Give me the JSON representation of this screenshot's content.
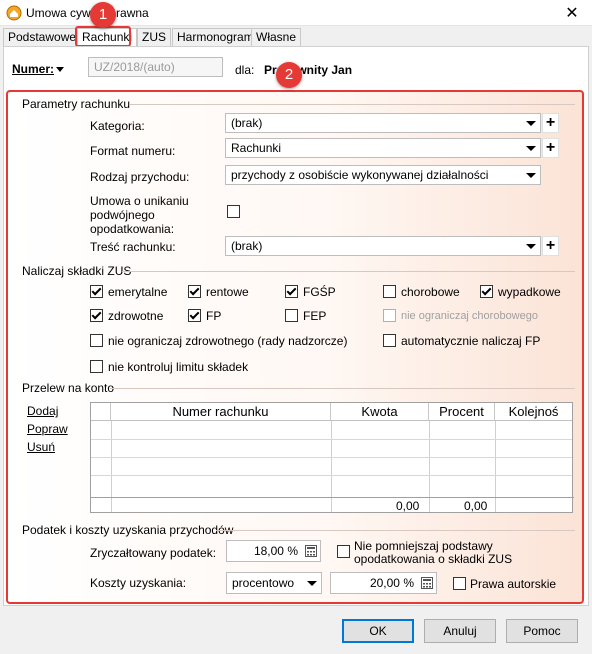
{
  "window": {
    "title": "Umowa cywilnoprawna",
    "close": "✕"
  },
  "tabs": [
    "Podstawowe",
    "Rachunki",
    "ZUS",
    "Harmonogram",
    "Własne"
  ],
  "callouts": [
    "1",
    "2"
  ],
  "header": {
    "numer_label": "Numer:",
    "numer_value": "UZ/2018/(auto)",
    "dla_label": "dla:",
    "person": "Pracownity Jan"
  },
  "parametry": {
    "group_title": "Parametry rachunku",
    "kategoria_label": "Kategoria:",
    "kategoria_value": "(brak)",
    "format_label": "Format numeru:",
    "format_value": "Rachunki",
    "rodzaj_label": "Rodzaj przychodu:",
    "rodzaj_value": "przychody z osobiście wykonywanej działalności",
    "umowa_label": "Umowa o unikaniu podwójnego opodatkowania:",
    "tresc_label": "Treść rachunku:",
    "tresc_value": "(brak)",
    "plus": "+"
  },
  "zus": {
    "group_title": "Naliczaj składki ZUS",
    "emerytalne": "emerytalne",
    "rentowe": "rentowe",
    "fgsp": "FGŚP",
    "chorobowe": "chorobowe",
    "wypadkowe": "wypadkowe",
    "zdrowotne": "zdrowotne",
    "fp": "FP",
    "fep": "FEP",
    "nie_ogr_chorobowego": "nie ograniczaj chorobowego",
    "nie_ogr_zdrowotnego": "nie ograniczaj zdrowotnego (rady nadzorcze)",
    "automatycznie_fp": "automatycznie naliczaj FP",
    "nie_kontroluj": "nie kontroluj limitu składek"
  },
  "przelew": {
    "group_title": "Przelew na konto",
    "dodaj": "Dodaj",
    "popraw": "Popraw",
    "usun": "Usuń",
    "columns": [
      "Numer rachunku",
      "Kwota",
      "Procent",
      "Kolejnoś"
    ],
    "sum_kwota": "0,00",
    "sum_procent": "0,00"
  },
  "podatek": {
    "group_title": "Podatek i koszty uzyskania przychodów",
    "zryczaltowany_label": "Zryczałtowany podatek:",
    "zryczaltowany_value": "18,00 %",
    "nie_pomniejszaj": "Nie pomniejszaj podstawy opodatkowania o składki ZUS",
    "koszty_label": "Koszty uzyskania:",
    "koszty_type": "procentowo",
    "koszty_value": "20,00 %",
    "prawa_autorskie": "Prawa autorskie"
  },
  "buttons": {
    "ok": "OK",
    "anuluj": "Anuluj",
    "pomoc": "Pomoc"
  },
  "colors": {
    "highlight": "#e53935",
    "accent": "#0078d7"
  }
}
